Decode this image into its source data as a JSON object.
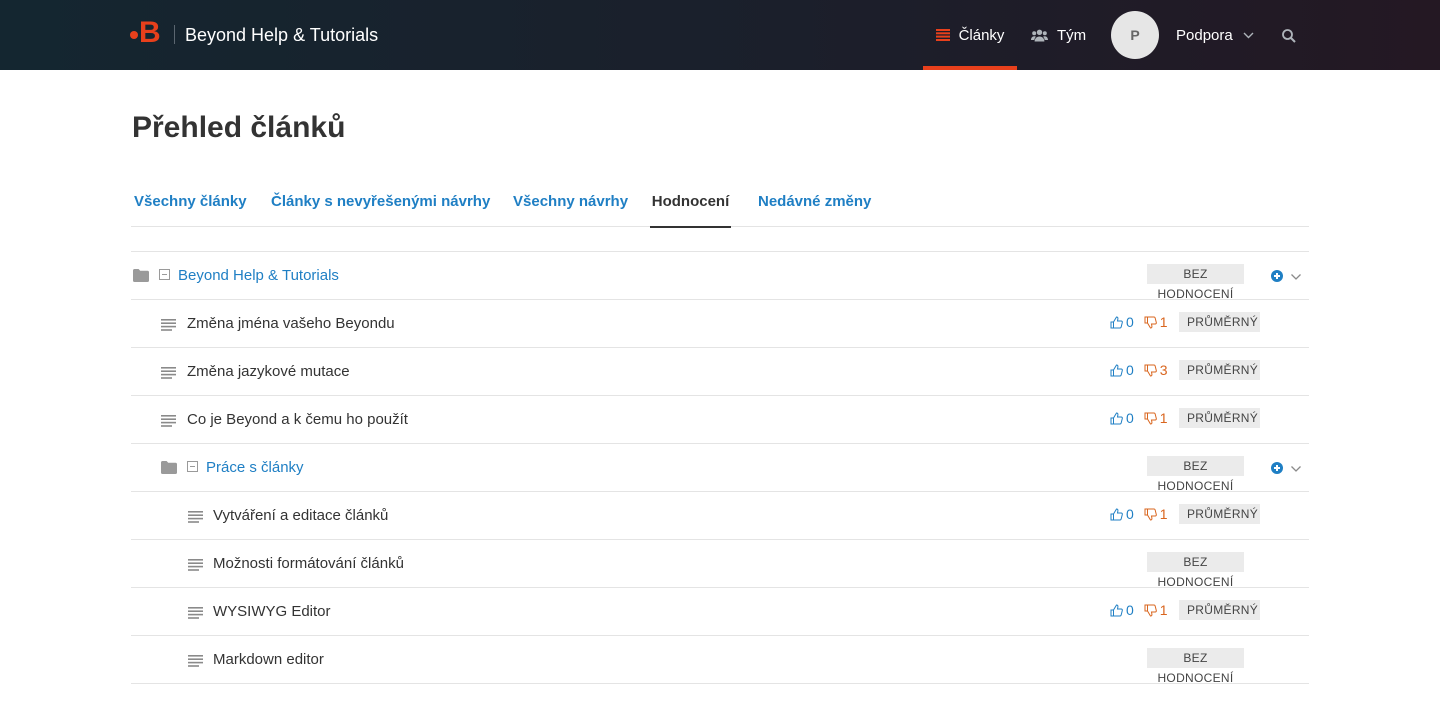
{
  "header": {
    "brand_title": "Beyond Help & Tutorials",
    "logo_letter": "B",
    "nav": {
      "articles_label": "Články",
      "team_label": "Tým",
      "avatar_initial": "P",
      "account_label": "Podpora"
    },
    "accent_color": "#e8401c"
  },
  "page": {
    "title": "Přehled článků"
  },
  "tabs": [
    {
      "label": "Všechny články",
      "active": false
    },
    {
      "label": "Články s nevyřešenými návrhy",
      "active": false
    },
    {
      "label": "Všechny návrhy",
      "active": false
    },
    {
      "label": "Hodnocení",
      "active": true
    },
    {
      "label": "Nedávné změny",
      "active": false
    }
  ],
  "rows": [
    {
      "type": "category",
      "label": "Beyond Help & Tutorials",
      "badge": "BEZ HODNOCENÍ"
    },
    {
      "type": "article",
      "label": "Změna jména vašeho Beyondu",
      "up": "0",
      "down": "1",
      "badge": "PRŮMĚRNÝ"
    },
    {
      "type": "article",
      "label": "Změna jazykové mutace",
      "up": "0",
      "down": "3",
      "badge": "PRŮMĚRNÝ"
    },
    {
      "type": "article",
      "label": "Co je Beyond a k čemu ho použít",
      "up": "0",
      "down": "1",
      "badge": "PRŮMĚRNÝ"
    },
    {
      "type": "category",
      "label": "Práce s články",
      "badge": "BEZ HODNOCENÍ"
    },
    {
      "type": "article",
      "label": "Vytváření a editace článků",
      "up": "0",
      "down": "1",
      "badge": "PRŮMĚRNÝ"
    },
    {
      "type": "article",
      "label": "Možnosti formátování článků",
      "badge": "BEZ HODNOCENÍ"
    },
    {
      "type": "article",
      "label": "WYSIWYG Editor",
      "up": "0",
      "down": "1",
      "badge": "PRŮMĚRNÝ"
    },
    {
      "type": "article",
      "label": "Markdown editor",
      "badge": "BEZ HODNOCENÍ"
    }
  ]
}
